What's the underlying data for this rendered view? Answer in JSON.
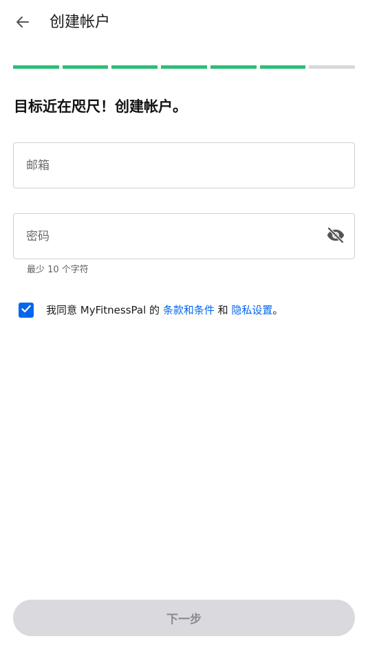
{
  "header": {
    "title": "创建帐户",
    "back_icon": "arrow-left-icon"
  },
  "progress": {
    "total_steps": 7,
    "completed_steps": 6,
    "done_color": "#2dbe79",
    "todo_color": "#d8d8dc"
  },
  "main": {
    "headline": "目标近在咫尺！创建帐户。",
    "email": {
      "placeholder": "邮箱",
      "value": ""
    },
    "password": {
      "placeholder": "密码",
      "value": "",
      "toggle_icon": "eye-off-icon",
      "helper": "最少 10 个字符"
    },
    "terms": {
      "checked": true,
      "prefix": "我同意 MyFitnessPal 的 ",
      "terms_link": "条款和条件",
      "conjunction": " 和 ",
      "privacy_link": "隐私设置",
      "suffix": "。",
      "link_color": "#0066ee"
    }
  },
  "footer": {
    "next_label": "下一步",
    "enabled": false
  }
}
